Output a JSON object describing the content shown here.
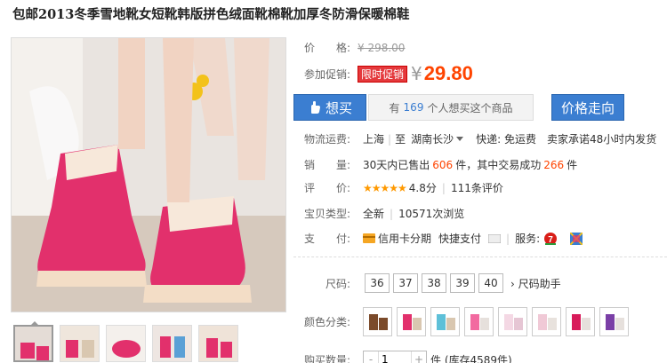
{
  "product": {
    "title": "包邮2013冬季雪地靴女短靴韩版拼色绒面靴棉靴加厚冬防滑保暖棉鞋"
  },
  "price": {
    "label": "价　　格:",
    "original": "¥ 298.00"
  },
  "promo": {
    "label": "参加促销:",
    "badge": "限时促销",
    "yen": "¥",
    "price": "29.80"
  },
  "actions": {
    "buy_label": "想买",
    "want_prefix": "有",
    "want_count": "169",
    "want_suffix": "个人想买这个商品",
    "trend_label": "价格走向"
  },
  "shipping": {
    "label": "物流运费:",
    "from": "上海",
    "to_prefix": "至",
    "to": "湖南长沙",
    "express": "快递: 免运费",
    "promise": "卖家承诺48小时内发货"
  },
  "sales": {
    "label": "销　　量:",
    "prefix": "30天内已售出",
    "sold": "606",
    "middle": "件，其中交易成功",
    "success": "266",
    "suffix": "件"
  },
  "rating": {
    "label": "评　　价:",
    "stars": "★★★★★",
    "score": "4.8分",
    "reviews": "111条评价"
  },
  "item_type": {
    "label": "宝贝类型:",
    "type": "全新",
    "views": "10571次浏览"
  },
  "payment": {
    "label": "支　　付:",
    "installment": "信用卡分期",
    "quick": "快捷支付",
    "service_label": "服务:"
  },
  "sizes": {
    "label": "尺码:",
    "options": [
      "36",
      "37",
      "38",
      "39",
      "40"
    ],
    "helper": "尺码助手"
  },
  "colors": {
    "label": "颜色分类:"
  },
  "quantity": {
    "label": "购买数量:",
    "value": "1",
    "stock": "件 (库存4589件)"
  },
  "theme": {
    "accent": "#3b7ed1",
    "price_color": "#ff4400",
    "promo_badge": "#e4393c"
  }
}
